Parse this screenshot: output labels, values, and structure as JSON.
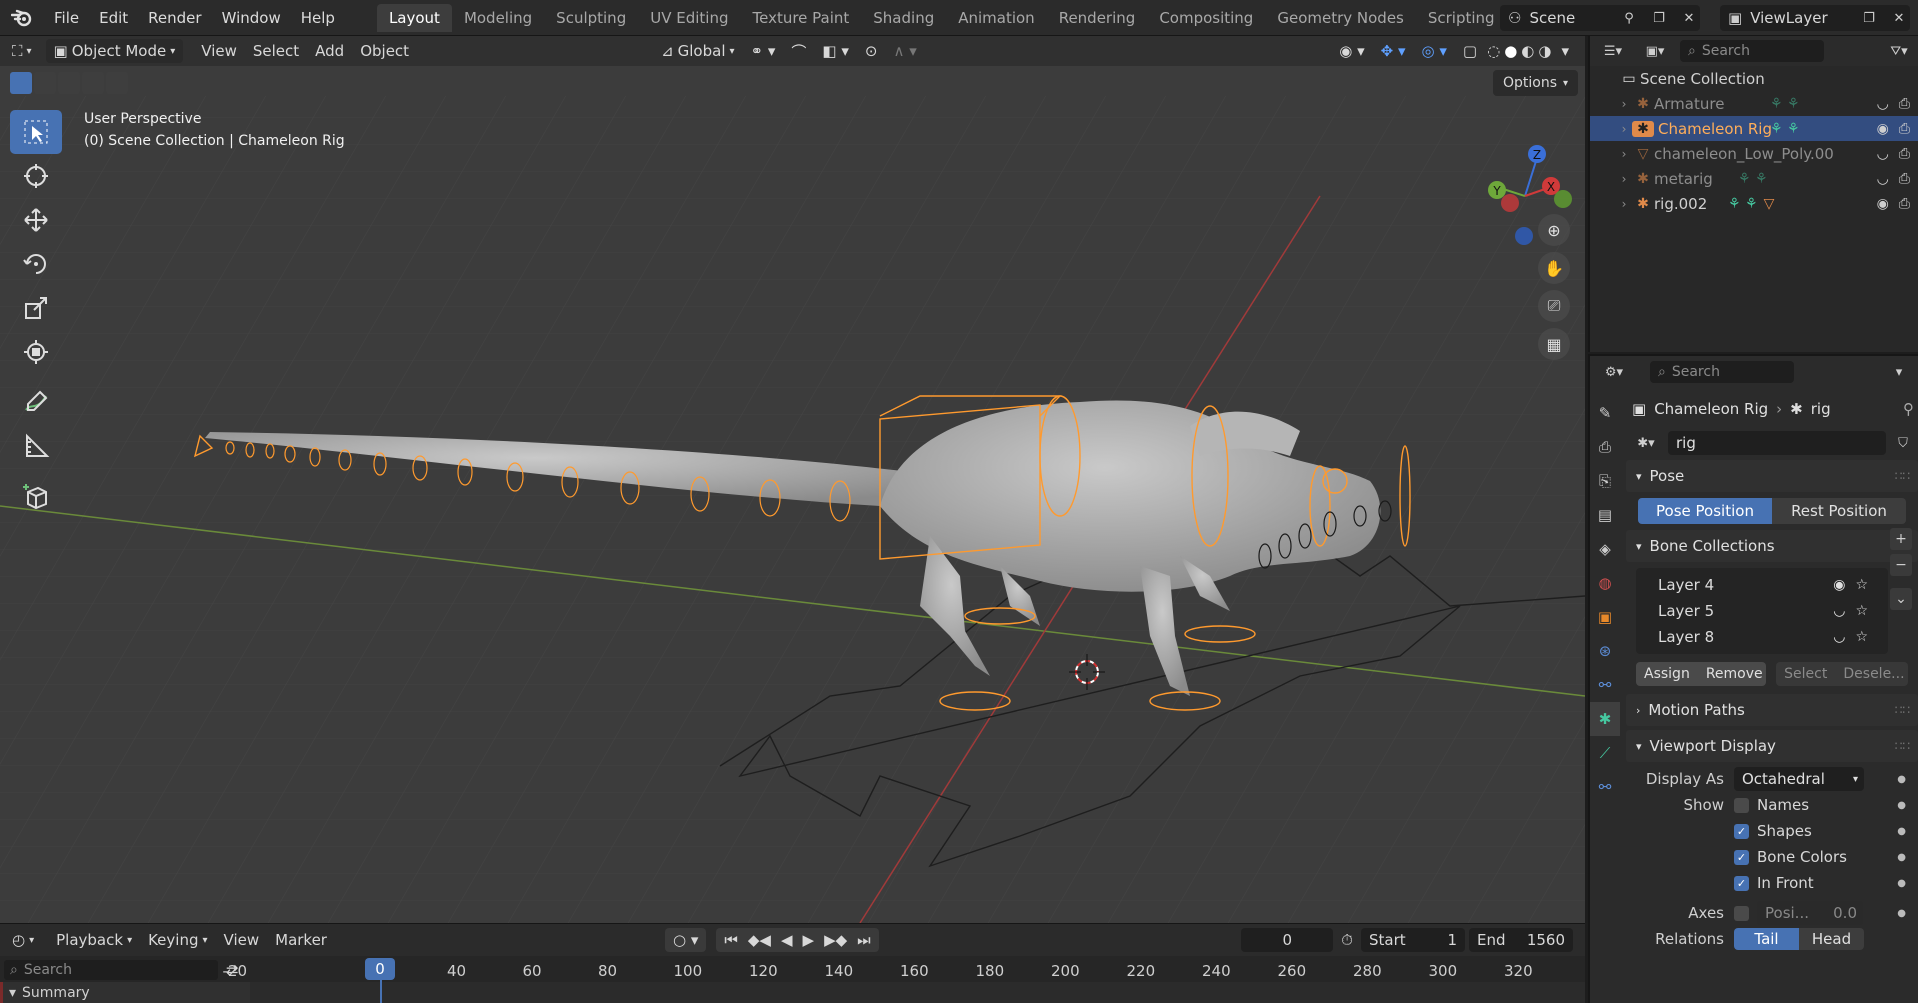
{
  "topbar": {
    "menus": [
      "File",
      "Edit",
      "Render",
      "Window",
      "Help"
    ],
    "workspaces": [
      "Layout",
      "Modeling",
      "Sculpting",
      "UV Editing",
      "Texture Paint",
      "Shading",
      "Animation",
      "Rendering",
      "Compositing",
      "Geometry Nodes",
      "Scripting"
    ],
    "active_workspace": "Layout",
    "scene": "Scene",
    "view_layer": "ViewLayer"
  },
  "viewport": {
    "mode": "Object Mode",
    "menus": [
      "View",
      "Select",
      "Add",
      "Object"
    ],
    "transform_orientation": "Global",
    "info_line1": "User Perspective",
    "info_line2": "(0) Scene Collection | Chameleon Rig",
    "options_label": "Options",
    "gizmo": {
      "z": "Z",
      "y": "Y",
      "x": "X"
    }
  },
  "timeline": {
    "menus": [
      "Playback",
      "Keying",
      "View",
      "Marker"
    ],
    "current_frame": "0",
    "start_label": "Start",
    "start_value": "1",
    "end_label": "End",
    "end_value": "1560",
    "search_placeholder": "Search",
    "ruler": [
      "-20",
      "0",
      "20",
      "40",
      "60",
      "80",
      "100",
      "120",
      "140",
      "160",
      "180",
      "200",
      "220",
      "240",
      "260",
      "280",
      "300",
      "320"
    ],
    "summary_label": "Summary"
  },
  "outliner": {
    "search_placeholder": "Search",
    "root": "Scene Collection",
    "items": [
      {
        "label": "Armature",
        "dim": true,
        "selected": false
      },
      {
        "label": "Chameleon Rig",
        "dim": false,
        "selected": true
      },
      {
        "label": "chameleon_Low_Poly.00",
        "dim": true,
        "selected": false
      },
      {
        "label": "metarig",
        "dim": true,
        "selected": false
      },
      {
        "label": "rig.002",
        "dim": false,
        "selected": false
      }
    ]
  },
  "properties": {
    "search_placeholder": "Search",
    "object_name": "Chameleon Rig",
    "data_name": "rig",
    "datablock": "rig",
    "pose_panel": "Pose",
    "pose_position": "Pose Position",
    "rest_position": "Rest Position",
    "bone_collections_panel": "Bone Collections",
    "bone_collections": [
      "Layer 4",
      "Layer 5",
      "Layer 8"
    ],
    "assign": "Assign",
    "remove": "Remove",
    "select": "Select",
    "deselect": "Desele...",
    "motion_paths_panel": "Motion Paths",
    "viewport_display_panel": "Viewport Display",
    "display_as_label": "Display As",
    "display_as_value": "Octahedral",
    "show_label": "Show",
    "show_names": "Names",
    "show_shapes": "Shapes",
    "show_bone_colors": "Bone Colors",
    "show_in_front": "In Front",
    "axes_label": "Axes",
    "axes_position": "Posi...",
    "axes_value": "0.0",
    "relations_label": "Relations",
    "tail": "Tail",
    "head": "Head"
  }
}
